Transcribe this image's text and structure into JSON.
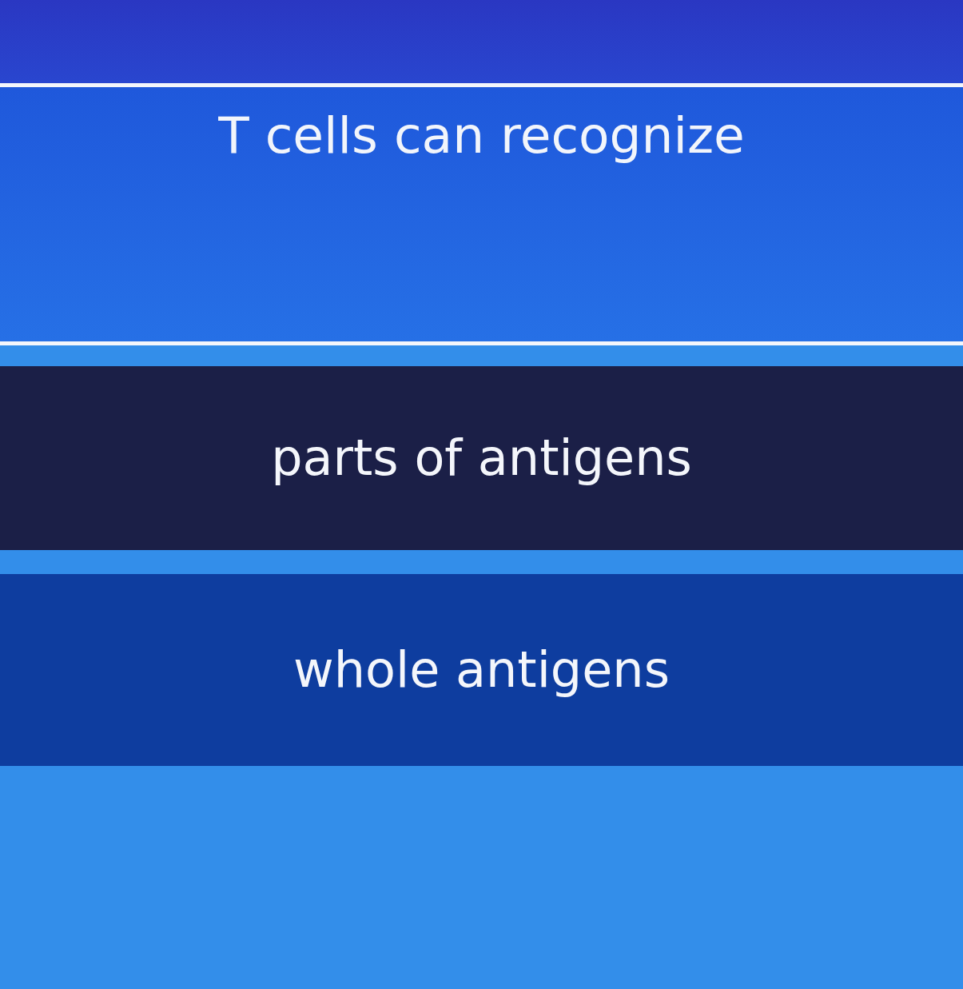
{
  "question": {
    "text": "T cells can recognize"
  },
  "options": [
    {
      "label": "parts of antigens",
      "selected": true
    },
    {
      "label": "whole antigens",
      "selected": false
    }
  ]
}
